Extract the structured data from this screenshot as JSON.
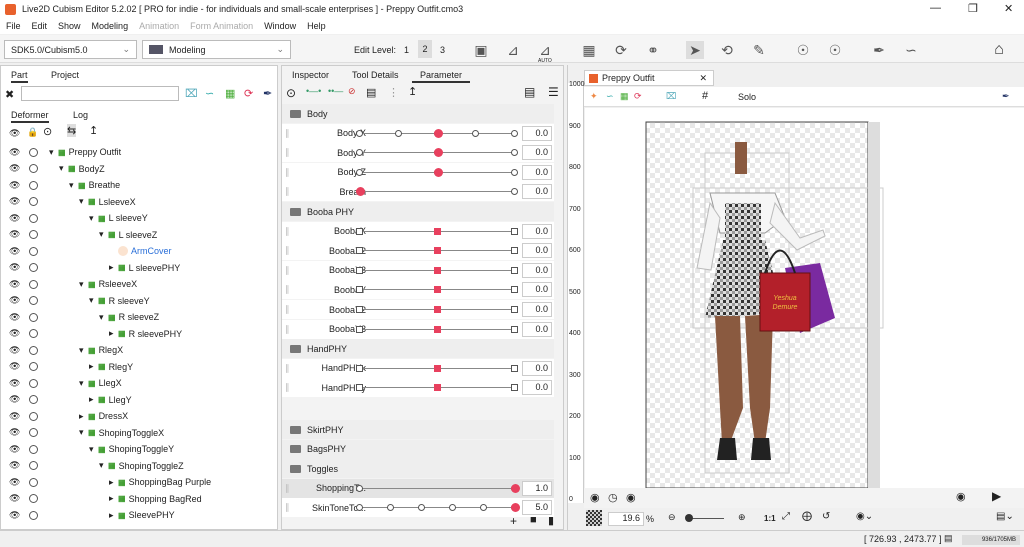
{
  "title": "Live2D Cubism Editor 5.2.02   [ PRO for indie - for individuals and small-scale enterprises ]  - Preppy Outfit.cmo3",
  "menu": [
    {
      "label": "File",
      "enabled": true
    },
    {
      "label": "Edit",
      "enabled": true
    },
    {
      "label": "Show",
      "enabled": true
    },
    {
      "label": "Modeling",
      "enabled": true
    },
    {
      "label": "Animation",
      "enabled": false
    },
    {
      "label": "Form Animation",
      "enabled": false
    },
    {
      "label": "Window",
      "enabled": true
    },
    {
      "label": "Help",
      "enabled": true
    }
  ],
  "toolbar": {
    "sdk": "SDK5.0/Cubism5.0",
    "mode": "Modeling",
    "edit_level_label": "Edit Level:",
    "levels": [
      "1",
      "2",
      "3"
    ],
    "active_level": "2",
    "auto": "AUTO"
  },
  "left": {
    "tabs": [
      "Part",
      "Project"
    ],
    "subtabs": [
      "Deformer",
      "Log"
    ],
    "tree": [
      {
        "label": "Preppy Outfit",
        "level": 0,
        "type": "part"
      },
      {
        "label": "BodyZ",
        "level": 1,
        "type": "def"
      },
      {
        "label": "Breathe",
        "level": 2,
        "type": "def"
      },
      {
        "label": "LsleeveX",
        "level": 3,
        "type": "def"
      },
      {
        "label": "L sleeveY",
        "level": 4,
        "type": "def"
      },
      {
        "label": "L sleeveZ",
        "level": 5,
        "type": "def"
      },
      {
        "label": "ArmCover",
        "level": 6,
        "type": "mesh"
      },
      {
        "label": "L sleevePHY",
        "level": 6,
        "type": "defc"
      },
      {
        "label": "RsleeveX",
        "level": 3,
        "type": "def"
      },
      {
        "label": "R sleeveY",
        "level": 4,
        "type": "def"
      },
      {
        "label": "R sleeveZ",
        "level": 5,
        "type": "def"
      },
      {
        "label": "R sleevePHY",
        "level": 6,
        "type": "defc"
      },
      {
        "label": "RlegX",
        "level": 3,
        "type": "def"
      },
      {
        "label": "RlegY",
        "level": 4,
        "type": "defc"
      },
      {
        "label": "LlegX",
        "level": 3,
        "type": "def"
      },
      {
        "label": "LlegY",
        "level": 4,
        "type": "defc"
      },
      {
        "label": "DressX",
        "level": 3,
        "type": "defc"
      },
      {
        "label": "ShopingToggleX",
        "level": 3,
        "type": "def"
      },
      {
        "label": "ShopingToggleY",
        "level": 4,
        "type": "def"
      },
      {
        "label": "ShopingToggleZ",
        "level": 5,
        "type": "def"
      },
      {
        "label": "ShoppingBag Purple",
        "level": 6,
        "type": "defc"
      },
      {
        "label": "Shopping BagRed",
        "level": 6,
        "type": "defc"
      },
      {
        "label": "SleevePHY",
        "level": 6,
        "type": "defc"
      }
    ]
  },
  "middle": {
    "tabs": [
      "Inspector",
      "Tool Details",
      "Parameter"
    ],
    "rows": [
      {
        "group": "Body"
      },
      {
        "name": "Body X",
        "value": "0.0",
        "keys": [
          0,
          0.25,
          0.5,
          0.75,
          1
        ],
        "pos": 0.5,
        "shape": "circle"
      },
      {
        "name": "Body Y",
        "value": "0.0",
        "keys": [
          0,
          0.5,
          1
        ],
        "pos": 0.5,
        "shape": "circle"
      },
      {
        "name": "Body Z",
        "value": "0.0",
        "keys": [
          0,
          0.5,
          1
        ],
        "pos": 0.5,
        "shape": "circle"
      },
      {
        "name": "Breath",
        "value": "0.0",
        "keys": [
          0,
          1
        ],
        "pos": 0,
        "shape": "circle"
      },
      {
        "group": "Booba PHY"
      },
      {
        "name": "BoobaX",
        "value": "0.0",
        "keys": [
          0,
          0.5,
          1
        ],
        "pos": 0.5,
        "shape": "square"
      },
      {
        "name": "BoobaX2",
        "value": "0.0",
        "keys": [
          0,
          0.5,
          1
        ],
        "pos": 0.5,
        "shape": "square"
      },
      {
        "name": "BoobaX3",
        "value": "0.0",
        "keys": [
          0,
          0.5,
          1
        ],
        "pos": 0.5,
        "shape": "square"
      },
      {
        "name": "BoobaY",
        "value": "0.0",
        "keys": [
          0,
          0.5,
          1
        ],
        "pos": 0.5,
        "shape": "square"
      },
      {
        "name": "BoobaY2",
        "value": "0.0",
        "keys": [
          0,
          0.5,
          1
        ],
        "pos": 0.5,
        "shape": "square"
      },
      {
        "name": "BoobaY3",
        "value": "0.0",
        "keys": [
          0,
          0.5,
          1
        ],
        "pos": 0.5,
        "shape": "square"
      },
      {
        "group": "HandPHY"
      },
      {
        "name": "HandPHYx",
        "value": "0.0",
        "keys": [
          0,
          0.5,
          1
        ],
        "pos": 0.5,
        "shape": "square"
      },
      {
        "name": "HandPHYy",
        "value": "0.0",
        "keys": [
          0,
          0.5,
          1
        ],
        "pos": 0.5,
        "shape": "square"
      },
      {
        "gap": true
      },
      {
        "group": "SkirtPHY"
      },
      {
        "group": "BagsPHY"
      },
      {
        "group": "Toggles"
      },
      {
        "name": "ShoppingT...",
        "value": "1.0",
        "keys": [
          0,
          1
        ],
        "pos": 1,
        "shape": "circle",
        "selected": true
      },
      {
        "name": "SkinToneTo...",
        "value": "5.0",
        "keys": [
          0,
          0.2,
          0.4,
          0.6,
          0.8,
          1
        ],
        "pos": 1,
        "shape": "circle"
      }
    ]
  },
  "canvas": {
    "tab": "Preppy Outfit",
    "solo": "Solo",
    "ruler": [
      "1000",
      "900",
      "800",
      "700",
      "600",
      "500",
      "400",
      "300",
      "200",
      "100",
      "0"
    ],
    "zoom": "19.6",
    "zoom_unit": "%",
    "one_to_one": "1:1",
    "bag_text": "Yeshua Demure"
  },
  "status": {
    "coords": "[ 726.93 , 2473.77 ]",
    "memory": "936/1705MB"
  }
}
